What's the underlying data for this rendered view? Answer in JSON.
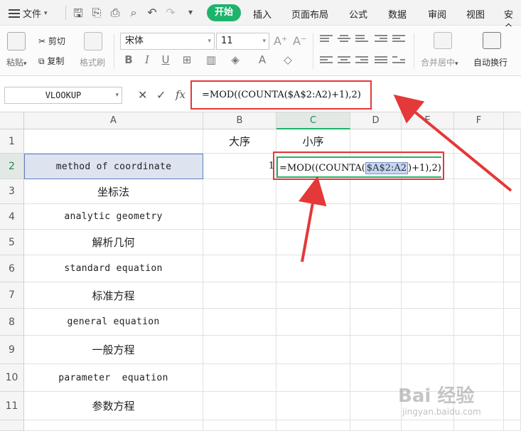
{
  "menu": {
    "file_label": "文件",
    "tabs": [
      {
        "label": "开始",
        "active": true
      },
      {
        "label": "插入",
        "active": false
      },
      {
        "label": "页面布局",
        "active": false
      },
      {
        "label": "公式",
        "active": false
      },
      {
        "label": "数据",
        "active": false
      },
      {
        "label": "审阅",
        "active": false
      },
      {
        "label": "视图",
        "active": false
      },
      {
        "label": "安全",
        "active": false
      }
    ]
  },
  "ribbon": {
    "paste_label": "粘贴",
    "cut_label": "剪切",
    "copy_label": "复制",
    "format_painter_label": "格式刷",
    "font_name": "宋体",
    "font_size": "11",
    "merge_center_label": "合并居中",
    "wrap_text_label": "自动换行"
  },
  "formula_bar": {
    "name_box": "VLOOKUP",
    "fx_label": "fx",
    "formula": "=MOD((COUNTA($A$2:A2)+1),2)"
  },
  "sheet": {
    "columns": [
      "A",
      "B",
      "C",
      "D",
      "E",
      "F"
    ],
    "rows": [
      "1",
      "2",
      "3",
      "4",
      "5",
      "6",
      "7",
      "8",
      "9",
      "10",
      "11"
    ],
    "header_b": "大序",
    "header_c": "小序",
    "a_values": [
      "",
      "method of coordinate",
      "坐标法",
      "analytic geometry",
      "解析几何",
      "standard equation",
      "标准方程",
      "general equation",
      "一般方程",
      "parameter  equation",
      "参数方程"
    ],
    "b2_value": "1",
    "editing": {
      "prefix": "=MOD((COUNTA(",
      "ref": "$A$2:A2",
      "suffix": ")+1),2)"
    }
  },
  "watermark": {
    "brand": "Bai 经验",
    "url": "jingyan.baidu.com"
  }
}
